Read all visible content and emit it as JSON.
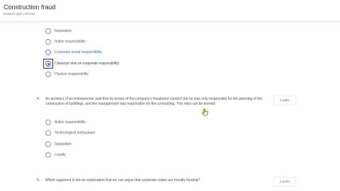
{
  "header": {
    "title": "Construction fraud",
    "subtitle": "Practice Quiz • 20 min"
  },
  "prev_question": {
    "options": [
      {
        "label": "Separation"
      },
      {
        "label": "Active responsibility"
      },
      {
        "label": "Corporate social responsibility"
      },
      {
        "label": "Classical view on corporate responsibility"
      },
      {
        "label": "Passive responsibility"
      }
    ],
    "selected_index": 3
  },
  "question4": {
    "number": "4.",
    "text": "An architect of an entrepreneur said that he knows of the company's fraudulent conduct but he was only responsible for the planning of the construction of buildings, and the management was responsible for the contracting. This view can be termed:",
    "points": "1 point",
    "options": [
      {
        "label": "Active responsibility"
      },
      {
        "label": "Technological enthusiasm"
      },
      {
        "label": "Separation"
      },
      {
        "label": "Loyalty"
      }
    ]
  },
  "question5": {
    "number": "5.",
    "text": "Which argument is not an explanation that we can argue that corporate codes are morally binding?",
    "points": "1 point"
  }
}
